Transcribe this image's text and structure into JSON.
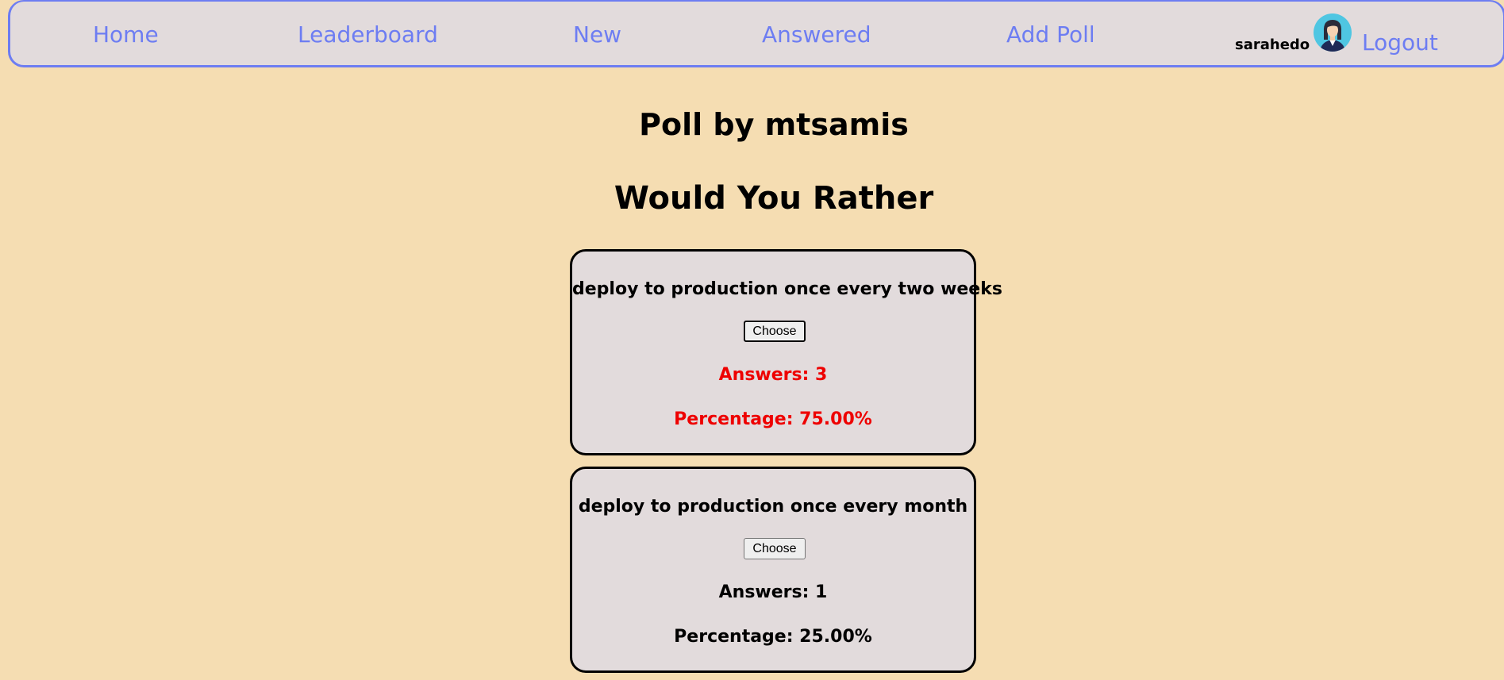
{
  "nav": {
    "home": "Home",
    "leaderboard": "Leaderboard",
    "new": "New",
    "answered": "Answered",
    "add_poll": "Add Poll",
    "username": "sarahedo",
    "logout": "Logout",
    "avatar_icon": "user-avatar-icon",
    "link_color": "#6d7df2"
  },
  "poll": {
    "title": "Poll by mtsamis",
    "question": "Would You Rather",
    "options": [
      {
        "text": "deploy to production once every two weeks",
        "choose_label": "Choose",
        "answers": "Answers: 3",
        "percentage": "Percentage: 75.00%",
        "highlight_color": "#ee0000",
        "selected": true
      },
      {
        "text": "deploy to production once every month",
        "choose_label": "Choose",
        "answers": "Answers: 1",
        "percentage": "Percentage: 25.00%",
        "highlight_color": "#000000",
        "selected": false
      }
    ]
  },
  "colors": {
    "page_background": "#f5ddb2",
    "card_background": "#e2dbdc",
    "nav_border": "#6d7df2"
  }
}
